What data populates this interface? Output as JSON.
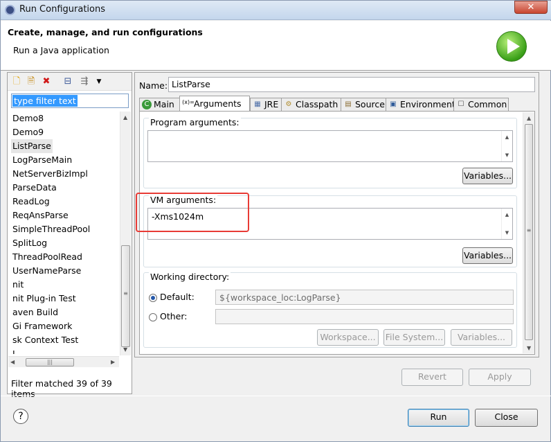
{
  "window": {
    "title": "Run Configurations",
    "close_glyph": "✕"
  },
  "header": {
    "title": "Create, manage, and run configurations",
    "subtitle": "Run a Java application",
    "icon": "run-icon"
  },
  "left": {
    "toolbar_icons": [
      "new-config-icon",
      "new-prototype-icon",
      "delete-icon",
      "collapse-all-icon",
      "filter-icon",
      "dropdown-icon"
    ],
    "filter_placeholder": "type filter text",
    "items": [
      "Demo8",
      "Demo9",
      "ListParse",
      "LogParseMain",
      "NetServerBizImpl",
      "ParseData",
      "ReadLog",
      "ReqAnsParse",
      "SimpleThreadPool",
      "SplitLog",
      "ThreadPoolRead",
      "UserNameParse",
      "nit",
      "nit Plug-in Test",
      "aven Build",
      "Gi Framework",
      "sk Context Test",
      "L"
    ],
    "selected_item": "ListParse",
    "status": "Filter matched 39 of 39 items"
  },
  "right": {
    "name_label": "Name:",
    "name_value": "ListParse",
    "tabs": [
      {
        "label": "Main",
        "icon": "main-icon",
        "glyph": "C"
      },
      {
        "label": "Arguments",
        "icon": "arguments-icon",
        "glyph": "(x)="
      },
      {
        "label": "JRE",
        "icon": "jre-icon",
        "glyph": "▦"
      },
      {
        "label": "Classpath",
        "icon": "classpath-icon",
        "glyph": "⚙"
      },
      {
        "label": "Source",
        "icon": "source-icon",
        "glyph": "▤"
      },
      {
        "label": "Environment",
        "icon": "environment-icon",
        "glyph": "▣"
      },
      {
        "label": "Common",
        "icon": "common-icon",
        "glyph": "☐"
      }
    ],
    "active_tab": "Arguments",
    "program_args_label": "Program arguments:",
    "program_args_value": "",
    "vm_args_label": "VM arguments:",
    "vm_args_value": "-Xms1024m",
    "variables_label": "Variables...",
    "working_dir_label": "Working directory:",
    "default_label": "Default:",
    "default_value": "${workspace_loc:LogParse}",
    "other_label": "Other:",
    "other_value": "",
    "workspace_btn": "Workspace...",
    "filesystem_btn": "File System...",
    "variables_btn_dis": "Variables...",
    "revert": "Revert",
    "apply": "Apply"
  },
  "footer": {
    "run": "Run",
    "close": "Close",
    "help": "?"
  },
  "colors": {
    "highlight": "#e83b35",
    "selection": "#3399ff"
  }
}
